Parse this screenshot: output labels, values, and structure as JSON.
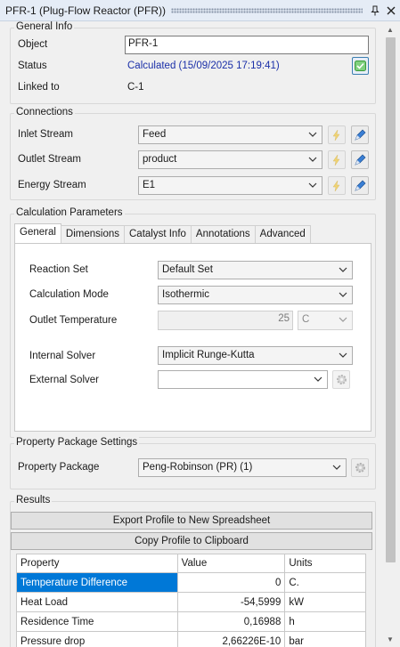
{
  "window": {
    "title": "PFR-1 (Plug-Flow Reactor (PFR))",
    "pin_icon": "pin-icon",
    "close_icon": "close-icon"
  },
  "general_info": {
    "title": "General Info",
    "object_label": "Object",
    "object_value": "PFR-1",
    "status_label": "Status",
    "status_value": "Calculated (15/09/2025 17:19:41)",
    "status_color": "#1a2fa8",
    "linked_label": "Linked to",
    "linked_value": "C-1"
  },
  "connections": {
    "title": "Connections",
    "inlet_label": "Inlet Stream",
    "inlet_value": "Feed",
    "outlet_label": "Outlet Stream",
    "outlet_value": "product",
    "energy_label": "Energy Stream",
    "energy_value": "E1"
  },
  "calc_params": {
    "title": "Calculation Parameters",
    "tabs": [
      "General",
      "Dimensions",
      "Catalyst Info",
      "Annotations",
      "Advanced"
    ],
    "active_tab": "General",
    "reaction_set_label": "Reaction Set",
    "reaction_set_value": "Default Set",
    "calc_mode_label": "Calculation Mode",
    "calc_mode_value": "Isothermic",
    "outlet_temp_label": "Outlet Temperature",
    "outlet_temp_value": "25",
    "outlet_temp_unit": "C",
    "internal_solver_label": "Internal Solver",
    "internal_solver_value": "Implicit Runge-Kutta",
    "external_solver_label": "External Solver",
    "external_solver_value": ""
  },
  "property_package": {
    "title": "Property Package Settings",
    "label": "Property Package",
    "value": "Peng-Robinson (PR) (1)"
  },
  "results": {
    "title": "Results",
    "export_button": "Export Profile to New Spreadsheet",
    "copy_button": "Copy Profile to Clipboard",
    "columns": {
      "property": "Property",
      "value": "Value",
      "units": "Units"
    },
    "rows": [
      {
        "property": "Temperature Difference",
        "value": "0",
        "units": "C."
      },
      {
        "property": "Heat Load",
        "value": "-54,5999",
        "units": "kW"
      },
      {
        "property": "Residence Time",
        "value": "0,16988",
        "units": "h"
      },
      {
        "property": "Pressure drop",
        "value": "2,66226E-10",
        "units": "bar"
      }
    ],
    "selection_color": "#0078d7"
  }
}
